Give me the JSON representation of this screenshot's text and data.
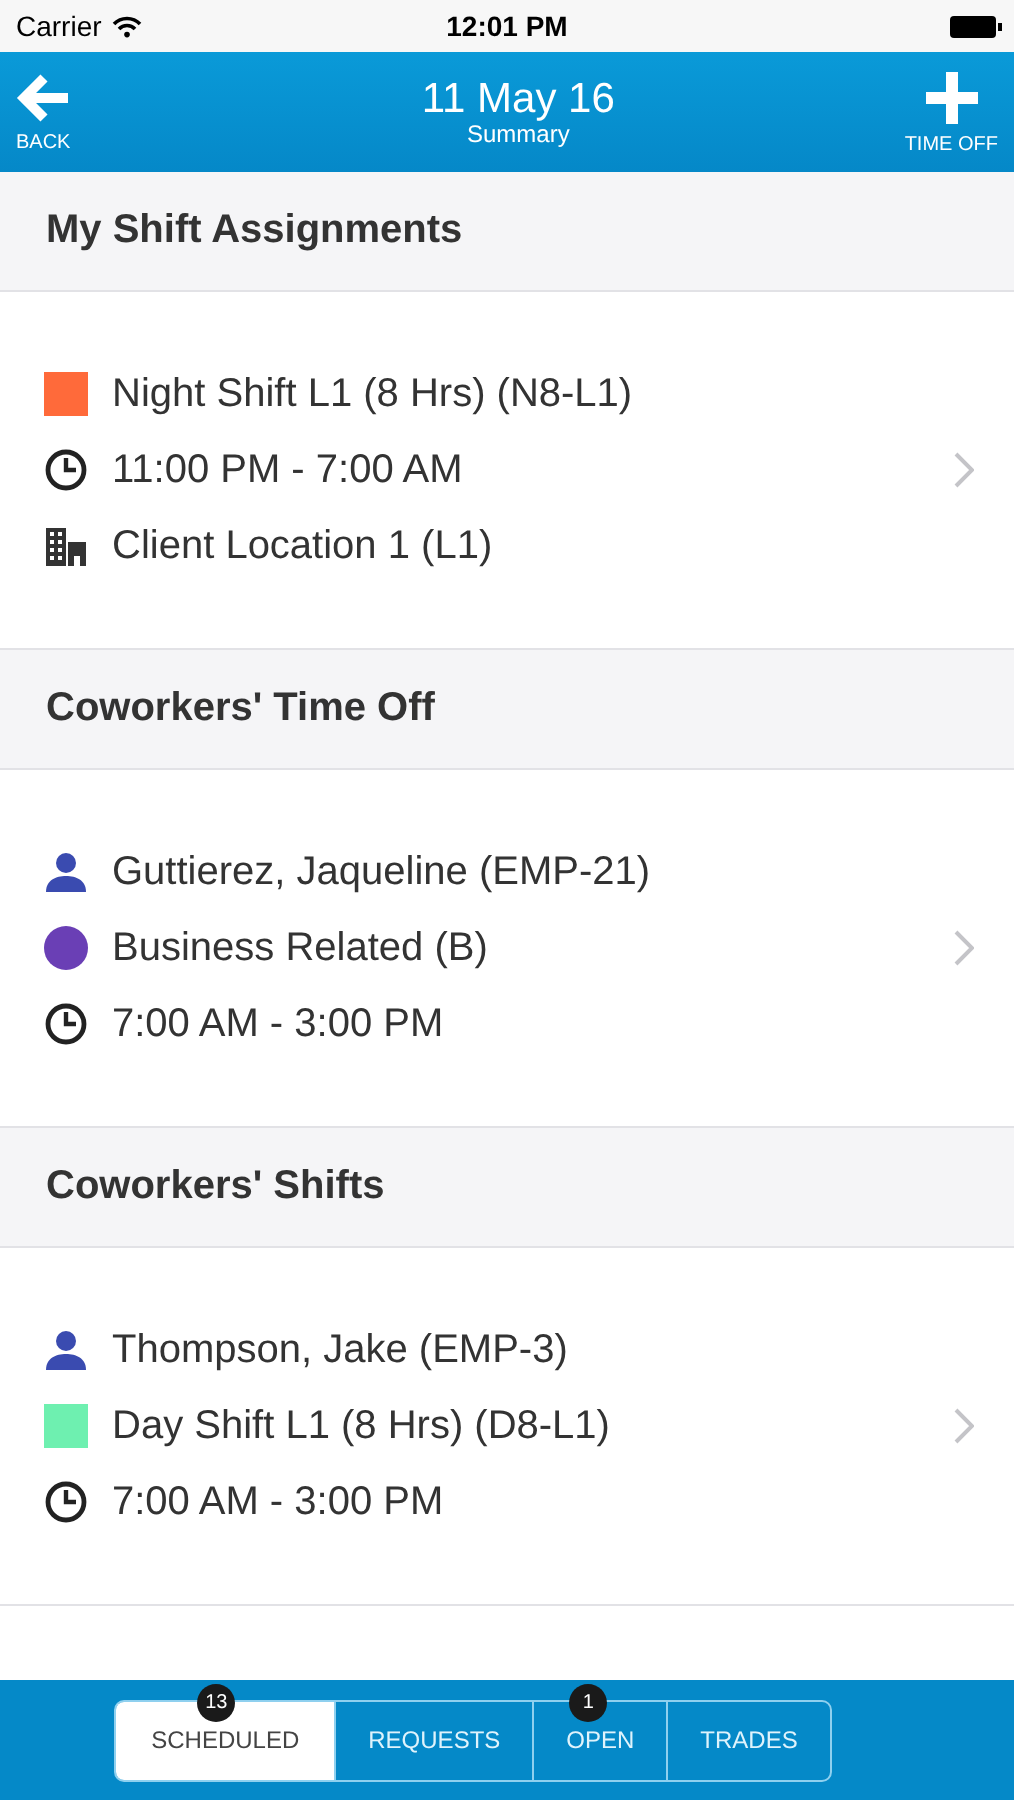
{
  "status_bar": {
    "carrier": "Carrier",
    "time": "12:01 PM"
  },
  "nav": {
    "back": "BACK",
    "title": "11 May 16",
    "subtitle": "Summary",
    "action": "TIME OFF"
  },
  "sections": [
    {
      "title": "My Shift Assignments",
      "lines": [
        {
          "kind": "swatch",
          "color": "#ff6a3a",
          "text": "Night Shift L1 (8 Hrs) (N8-L1)"
        },
        {
          "kind": "clock",
          "text": "11:00 PM - 7:00 AM"
        },
        {
          "kind": "building",
          "text": "Client Location 1 (L1)"
        }
      ]
    },
    {
      "title": "Coworkers' Time Off",
      "lines": [
        {
          "kind": "person",
          "text": "Guttierez, Jaqueline (EMP-21)"
        },
        {
          "kind": "dot",
          "color": "#6a3fb5",
          "text": "Business Related (B)"
        },
        {
          "kind": "clock",
          "text": "7:00 AM - 3:00 PM"
        }
      ]
    },
    {
      "title": "Coworkers' Shifts",
      "lines": [
        {
          "kind": "person",
          "text": "Thompson, Jake (EMP-3)"
        },
        {
          "kind": "swatch",
          "color": "#6ef0b0",
          "text": "Day Shift L1 (8 Hrs) (D8-L1)"
        },
        {
          "kind": "clock",
          "text": "7:00 AM - 3:00 PM"
        }
      ]
    }
  ],
  "tabs": [
    {
      "label": "SCHEDULED",
      "selected": true,
      "badge": "13"
    },
    {
      "label": "REQUESTS",
      "selected": false
    },
    {
      "label": "OPEN",
      "selected": false,
      "badge": "1"
    },
    {
      "label": "TRADES",
      "selected": false
    }
  ]
}
